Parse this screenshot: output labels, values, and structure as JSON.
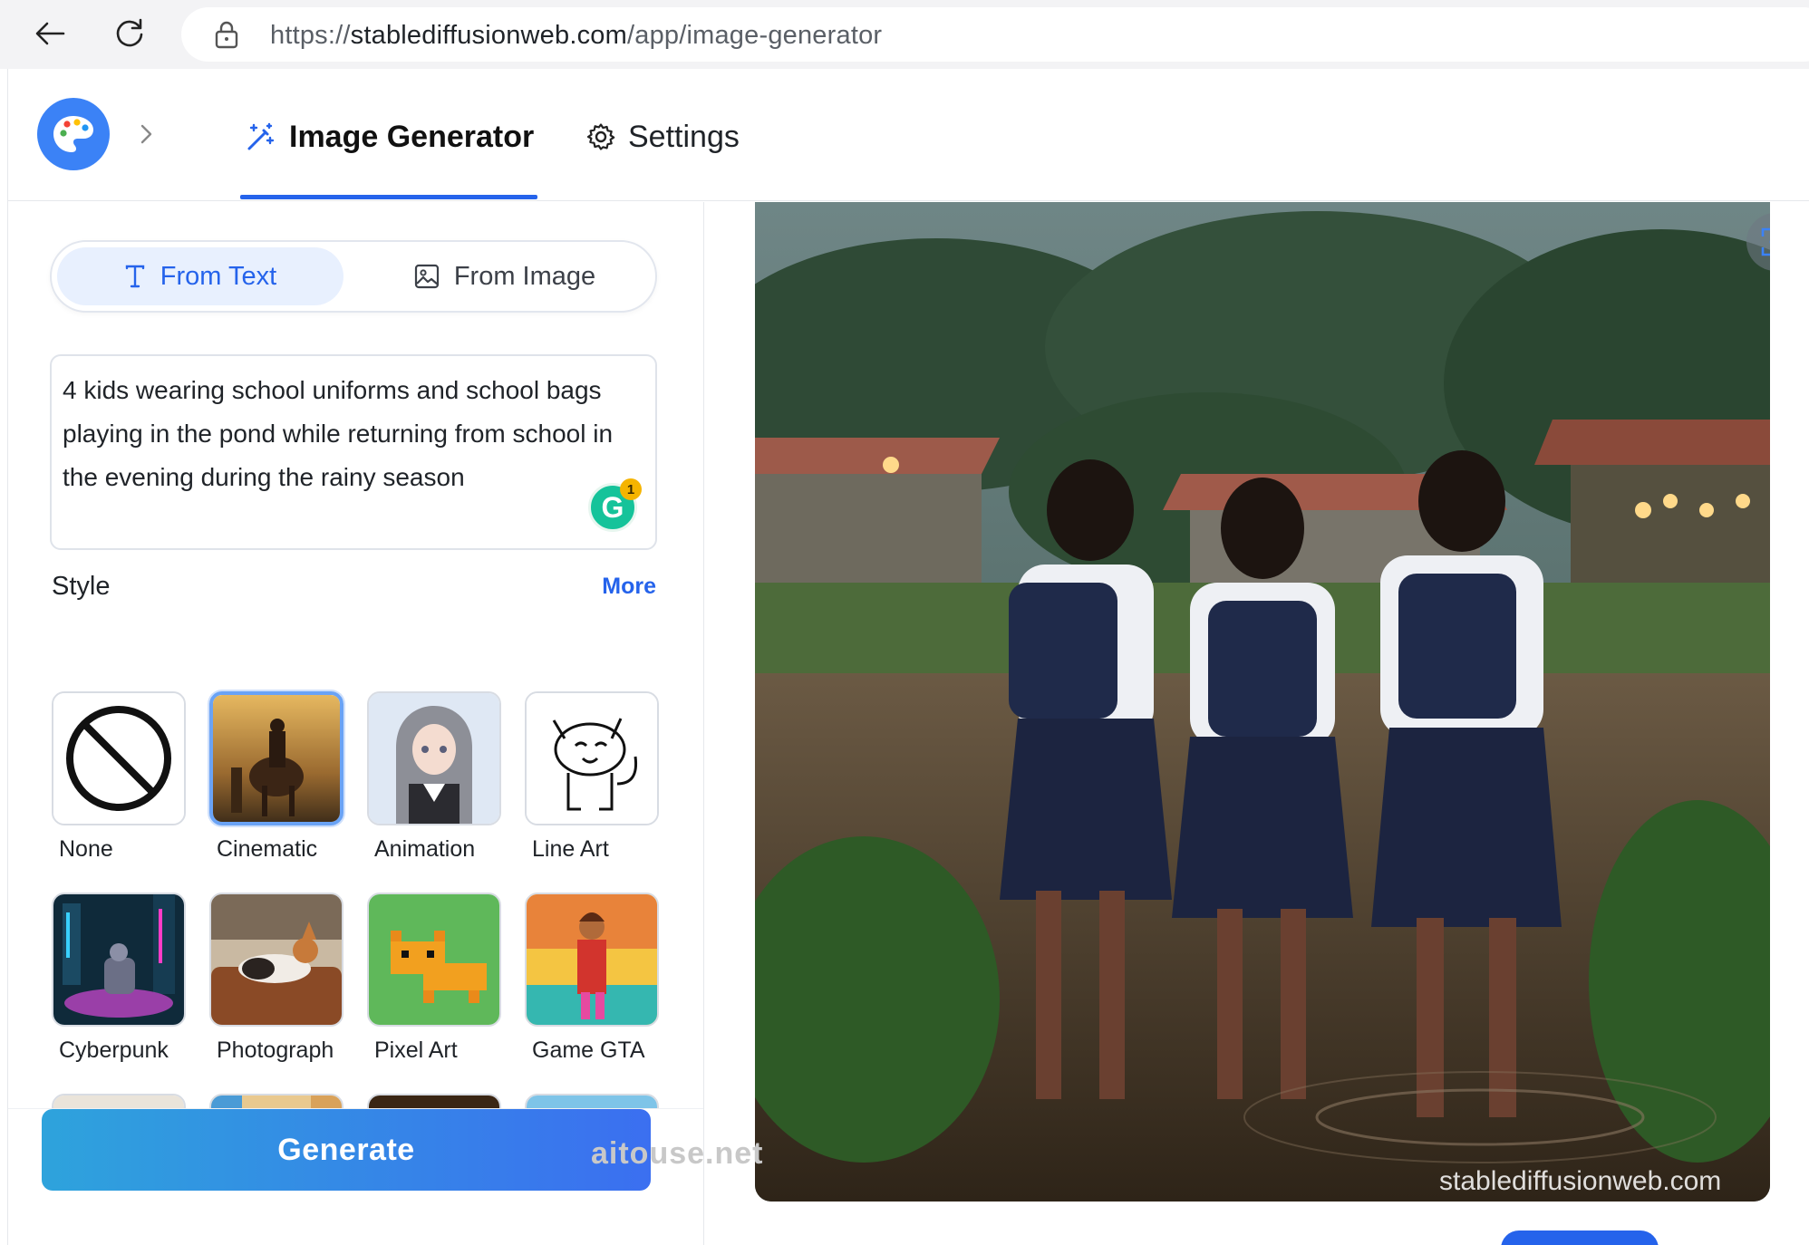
{
  "browser": {
    "url_scheme": "https://",
    "url_host": "stablediffusionweb.com",
    "url_path": "/app/image-generator"
  },
  "header": {
    "tabs": [
      {
        "label": "Image Generator",
        "icon": "magic-wand-icon",
        "active": true
      },
      {
        "label": "Settings",
        "icon": "gear-icon",
        "active": false
      }
    ],
    "accent_color": "#2563eb"
  },
  "mode_switch": {
    "options": [
      {
        "label": "From Text",
        "icon": "text-icon",
        "selected": true
      },
      {
        "label": "From Image",
        "icon": "image-icon",
        "selected": false
      }
    ]
  },
  "prompt": {
    "value": "4 kids wearing school uniforms and school bags playing in the pond while returning from school in the evening during the rainy season",
    "grammarly_count": "1"
  },
  "style_section": {
    "label": "Style",
    "more_label": "More",
    "selected": "Cinematic",
    "styles": [
      {
        "name": "None"
      },
      {
        "name": "Cinematic"
      },
      {
        "name": "Animation"
      },
      {
        "name": "Line Art"
      },
      {
        "name": "Cyberpunk"
      },
      {
        "name": "Photograph"
      },
      {
        "name": "Pixel Art"
      },
      {
        "name": "Game GTA"
      }
    ]
  },
  "generate_label": "Generate",
  "watermarks": {
    "page": "aitouse.net",
    "image": "stablediffusionweb.com"
  }
}
